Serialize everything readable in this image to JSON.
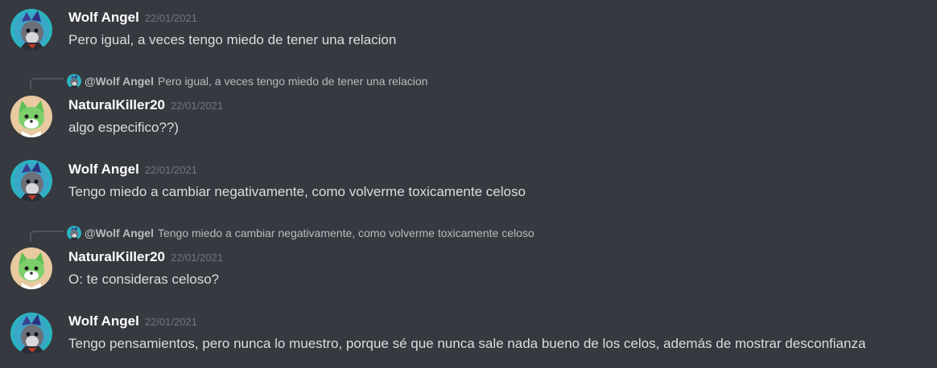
{
  "messages": [
    {
      "author": "Wolf Angel",
      "timestamp": "22/01/2021",
      "text": "Pero igual, a veces tengo miedo de tener una relacion"
    },
    {
      "author": "NaturalKiller20",
      "timestamp": "22/01/2021",
      "text": "algo especifico??)",
      "reply": {
        "mention": "@Wolf Angel",
        "text": "Pero igual, a veces tengo miedo de tener una relacion"
      }
    },
    {
      "author": "Wolf Angel",
      "timestamp": "22/01/2021",
      "text": "Tengo miedo a cambiar negativamente, como volverme toxicamente celoso"
    },
    {
      "author": "NaturalKiller20",
      "timestamp": "22/01/2021",
      "text": "O: te consideras celoso?",
      "reply": {
        "mention": "@Wolf Angel",
        "text": "Tengo miedo a cambiar negativamente, como volverme toxicamente celoso"
      }
    },
    {
      "author": "Wolf Angel",
      "timestamp": "22/01/2021",
      "text": "Tengo pensamientos, pero nunca lo muestro, porque sé que nunca sale nada bueno de los celos, además de mostrar desconfianza"
    }
  ],
  "avatars": {
    "wolf-angel": {
      "icon": "wolf-avatar-icon",
      "colors": [
        "#2bb3c0",
        "#3a3f8f",
        "#555a66"
      ]
    },
    "naturalkiller20": {
      "icon": "fox-avatar-icon",
      "colors": [
        "#e8c9a0",
        "#7ccf6a",
        "#ffffff"
      ]
    }
  },
  "theme": {
    "background": "#36393f",
    "username_color": "#ffffff",
    "timestamp_color": "#72767d",
    "text_color": "#dcddde",
    "reply_color": "#b9bbbe"
  }
}
